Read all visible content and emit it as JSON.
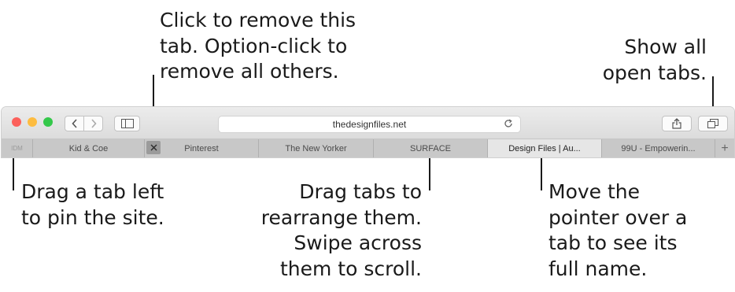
{
  "callouts": {
    "close_tab": "Click to remove this\ntab. Option-click to\nremove all others.",
    "show_all": "Show all\nopen tabs.",
    "pin": "Drag a tab left\nto pin the site.",
    "rearrange": "Drag tabs to\nrearrange them.\nSwipe across\nthem to scroll.",
    "hover": "Move the\npointer over a\ntab to see its\nfull name."
  },
  "window": {
    "traffic_lights": [
      "#fc605b",
      "#fdbc40",
      "#34c84a"
    ],
    "url": "thedesignfiles.net",
    "icons": [
      "back-icon",
      "forward-icon",
      "sidebar-icon",
      "reload-icon",
      "share-icon",
      "tab-overview-icon",
      "close-icon",
      "new-tab-icon"
    ]
  },
  "tabs": {
    "pinned": "IDM",
    "items": [
      {
        "label": "Kid & Coe"
      },
      {
        "label": "Pinterest"
      },
      {
        "label": "The New Yorker"
      },
      {
        "label": "SURFACE"
      },
      {
        "label": "Design Files | Au..."
      },
      {
        "label": "99U - Empowerin..."
      }
    ],
    "new_tab": "+"
  }
}
